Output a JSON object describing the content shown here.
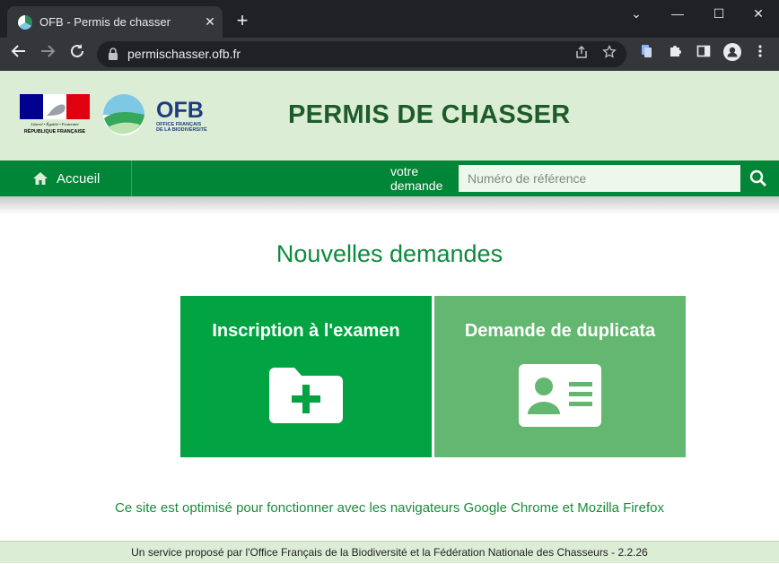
{
  "browser": {
    "tab_title": "OFB - Permis de chasser",
    "tab_close": "✕",
    "new_tab": "+",
    "url": "permischasser.ofb.fr",
    "window_controls": [
      "⌄",
      "—",
      "☐",
      "✕"
    ]
  },
  "header": {
    "republique_lines": [
      "Liberté • Égalité • Fraternité",
      "RÉPUBLIQUE FRANÇAISE"
    ],
    "ofb_name": "OFB",
    "ofb_sub": [
      "OFFICE FRANÇAIS",
      "DE LA BIODIVERSITÉ"
    ],
    "title": "PERMIS DE CHASSER"
  },
  "nav": {
    "home_label": "Accueil",
    "votre_line1": "votre",
    "votre_line2": "demande",
    "search_placeholder": "Numéro de référence"
  },
  "main": {
    "section_title": "Nouvelles demandes",
    "cards": [
      {
        "label": "Inscription à l'examen",
        "icon": "folder-plus-icon"
      },
      {
        "label": "Demande de duplicata",
        "icon": "id-card-icon"
      }
    ],
    "optim_note": "Ce site est optimisé pour fonctionner avec les navigateurs Google Chrome et Mozilla Firefox"
  },
  "footer": {
    "text": "Un service proposé par l'Office Français de la Biodiversité et la Fédération Nationale des Chasseurs - 2.2.26"
  },
  "colors": {
    "header_bg": "#dcedd6",
    "nav_bg": "#018536",
    "card1": "#02a343",
    "card2": "#63b770",
    "title_green": "#1d5c2a"
  }
}
